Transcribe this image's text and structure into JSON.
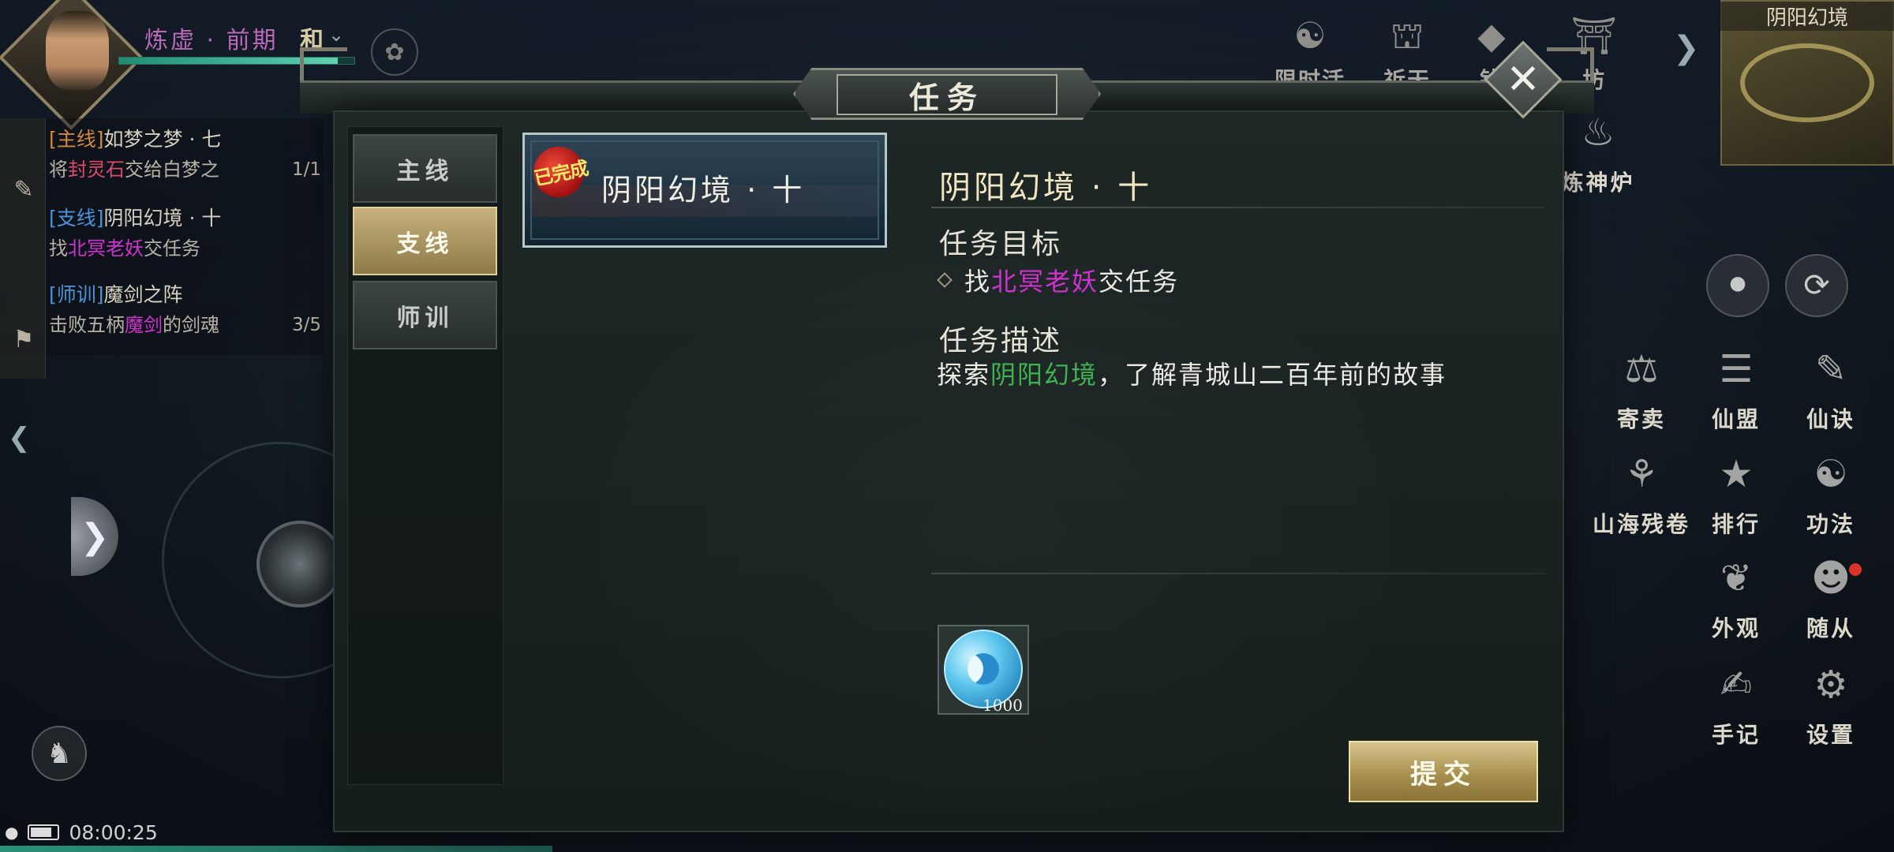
{
  "player": {
    "realm": "炼虚 · 前期",
    "mood": "和",
    "hp_fill": 0.93
  },
  "tracker": {
    "quests": [
      {
        "tag": "[主线]",
        "name": "如梦之梦 · 七",
        "line2_pre": "将",
        "line2_hl": "封灵石",
        "line2_post": "交给白梦之",
        "progress": "1/1"
      },
      {
        "tag": "[支线]",
        "name": "阴阳幻境 · 十",
        "line2_pre": "找",
        "line2_hl": "北冥老妖",
        "line2_post": "交任务",
        "progress": ""
      },
      {
        "tag": "[师训]",
        "name": "魔剑之阵",
        "line2_pre": "击败五柄",
        "line2_hl": "魔剑",
        "line2_post": "的剑魂",
        "progress": "3/5"
      }
    ]
  },
  "status_bar": {
    "time": "08:00:25",
    "battery_level": 0.8
  },
  "top_menu": [
    {
      "icon": "limited-event-icon",
      "label": "限时活动"
    },
    {
      "icon": "pray-icon",
      "label": "祈天"
    },
    {
      "icon": "money-icon",
      "label": "钱"
    },
    {
      "icon": "workshop-icon",
      "label": "坊"
    }
  ],
  "minimap": {
    "title": "阴阳幻境"
  },
  "right_menu": {
    "forge_label": "炼神炉",
    "items": [
      {
        "icon": "auction-icon",
        "label": "寄卖"
      },
      {
        "icon": "alliance-icon",
        "label": "仙盟"
      },
      {
        "icon": "secret-icon",
        "label": "仙诀"
      },
      {
        "icon": "scroll-icon",
        "label": "山海残卷"
      },
      {
        "icon": "ranking-icon",
        "label": "排行"
      },
      {
        "icon": "taiji-icon",
        "label": "功法"
      },
      {
        "icon": "appearance-icon",
        "label": "外观"
      },
      {
        "icon": "follower-icon",
        "label": "随从"
      },
      {
        "icon": "notebook-icon",
        "label": "手记"
      },
      {
        "icon": "gear-icon",
        "label": "设置"
      }
    ]
  },
  "dialog": {
    "title": "任务",
    "tabs": [
      {
        "label": "主线",
        "active": false
      },
      {
        "label": "支线",
        "active": true
      },
      {
        "label": "师训",
        "active": false
      }
    ],
    "quest_card": {
      "badge": "已完成",
      "title": "阴阳幻境 · 十"
    },
    "detail": {
      "title": "阴阳幻境 · 十",
      "objective_heading": "任务目标",
      "objective_pre": "找",
      "objective_hl": "北冥老妖",
      "objective_post": "交任务",
      "description_heading": "任务描述",
      "description_pre": "探索",
      "description_hl": "阴阳幻境",
      "description_post": "，了解青城山二百年前的故事"
    },
    "reward": {
      "icon": "yin-yang-orb-icon",
      "count": "1000"
    },
    "submit_label": "提交"
  },
  "colors": {
    "accent_gold": "#c7b27c",
    "highlight_pink": "#d032d0",
    "highlight_green": "#3fb34f",
    "main_quest_tag": "#d28a3a",
    "branch_quest_tag": "#4d92d8"
  }
}
